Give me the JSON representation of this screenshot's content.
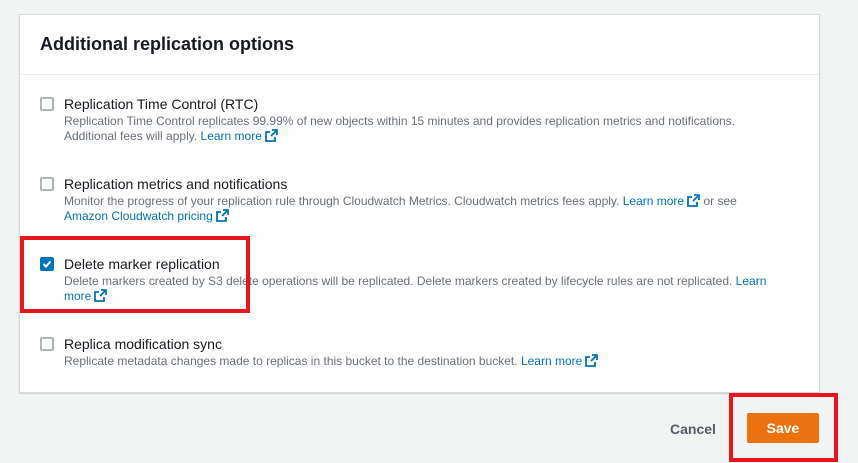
{
  "panel": {
    "title": "Additional replication options",
    "options": [
      {
        "label": "Replication Time Control (RTC)",
        "checked": false,
        "desc": "Replication Time Control replicates 99.99% of new objects within 15 minutes and provides replication metrics and notifications.",
        "desc2": "Additional fees will apply.",
        "link": "Learn more"
      },
      {
        "label": "Replication metrics and notifications",
        "checked": false,
        "desc": "Monitor the progress of your replication rule through Cloudwatch Metrics. Cloudwatch metrics fees apply.",
        "link": "Learn more",
        "mid": "or see",
        "link2": "Amazon Cloudwatch pricing"
      },
      {
        "label": "Delete marker replication",
        "checked": true,
        "desc": "Delete markers created by S3 delete operations will be replicated. Delete markers created by lifecycle rules are not replicated.",
        "link_a": "Learn",
        "link_b": "more"
      },
      {
        "label": "Replica modification sync",
        "checked": false,
        "desc": "Replicate metadata changes made to replicas in this bucket to the destination bucket.",
        "link": "Learn more"
      }
    ]
  },
  "actions": {
    "cancel_label": "Cancel",
    "save_label": "Save"
  },
  "colors": {
    "accent": "#0073bb",
    "primary_button": "#ec7211",
    "highlight": "#e8151f"
  }
}
